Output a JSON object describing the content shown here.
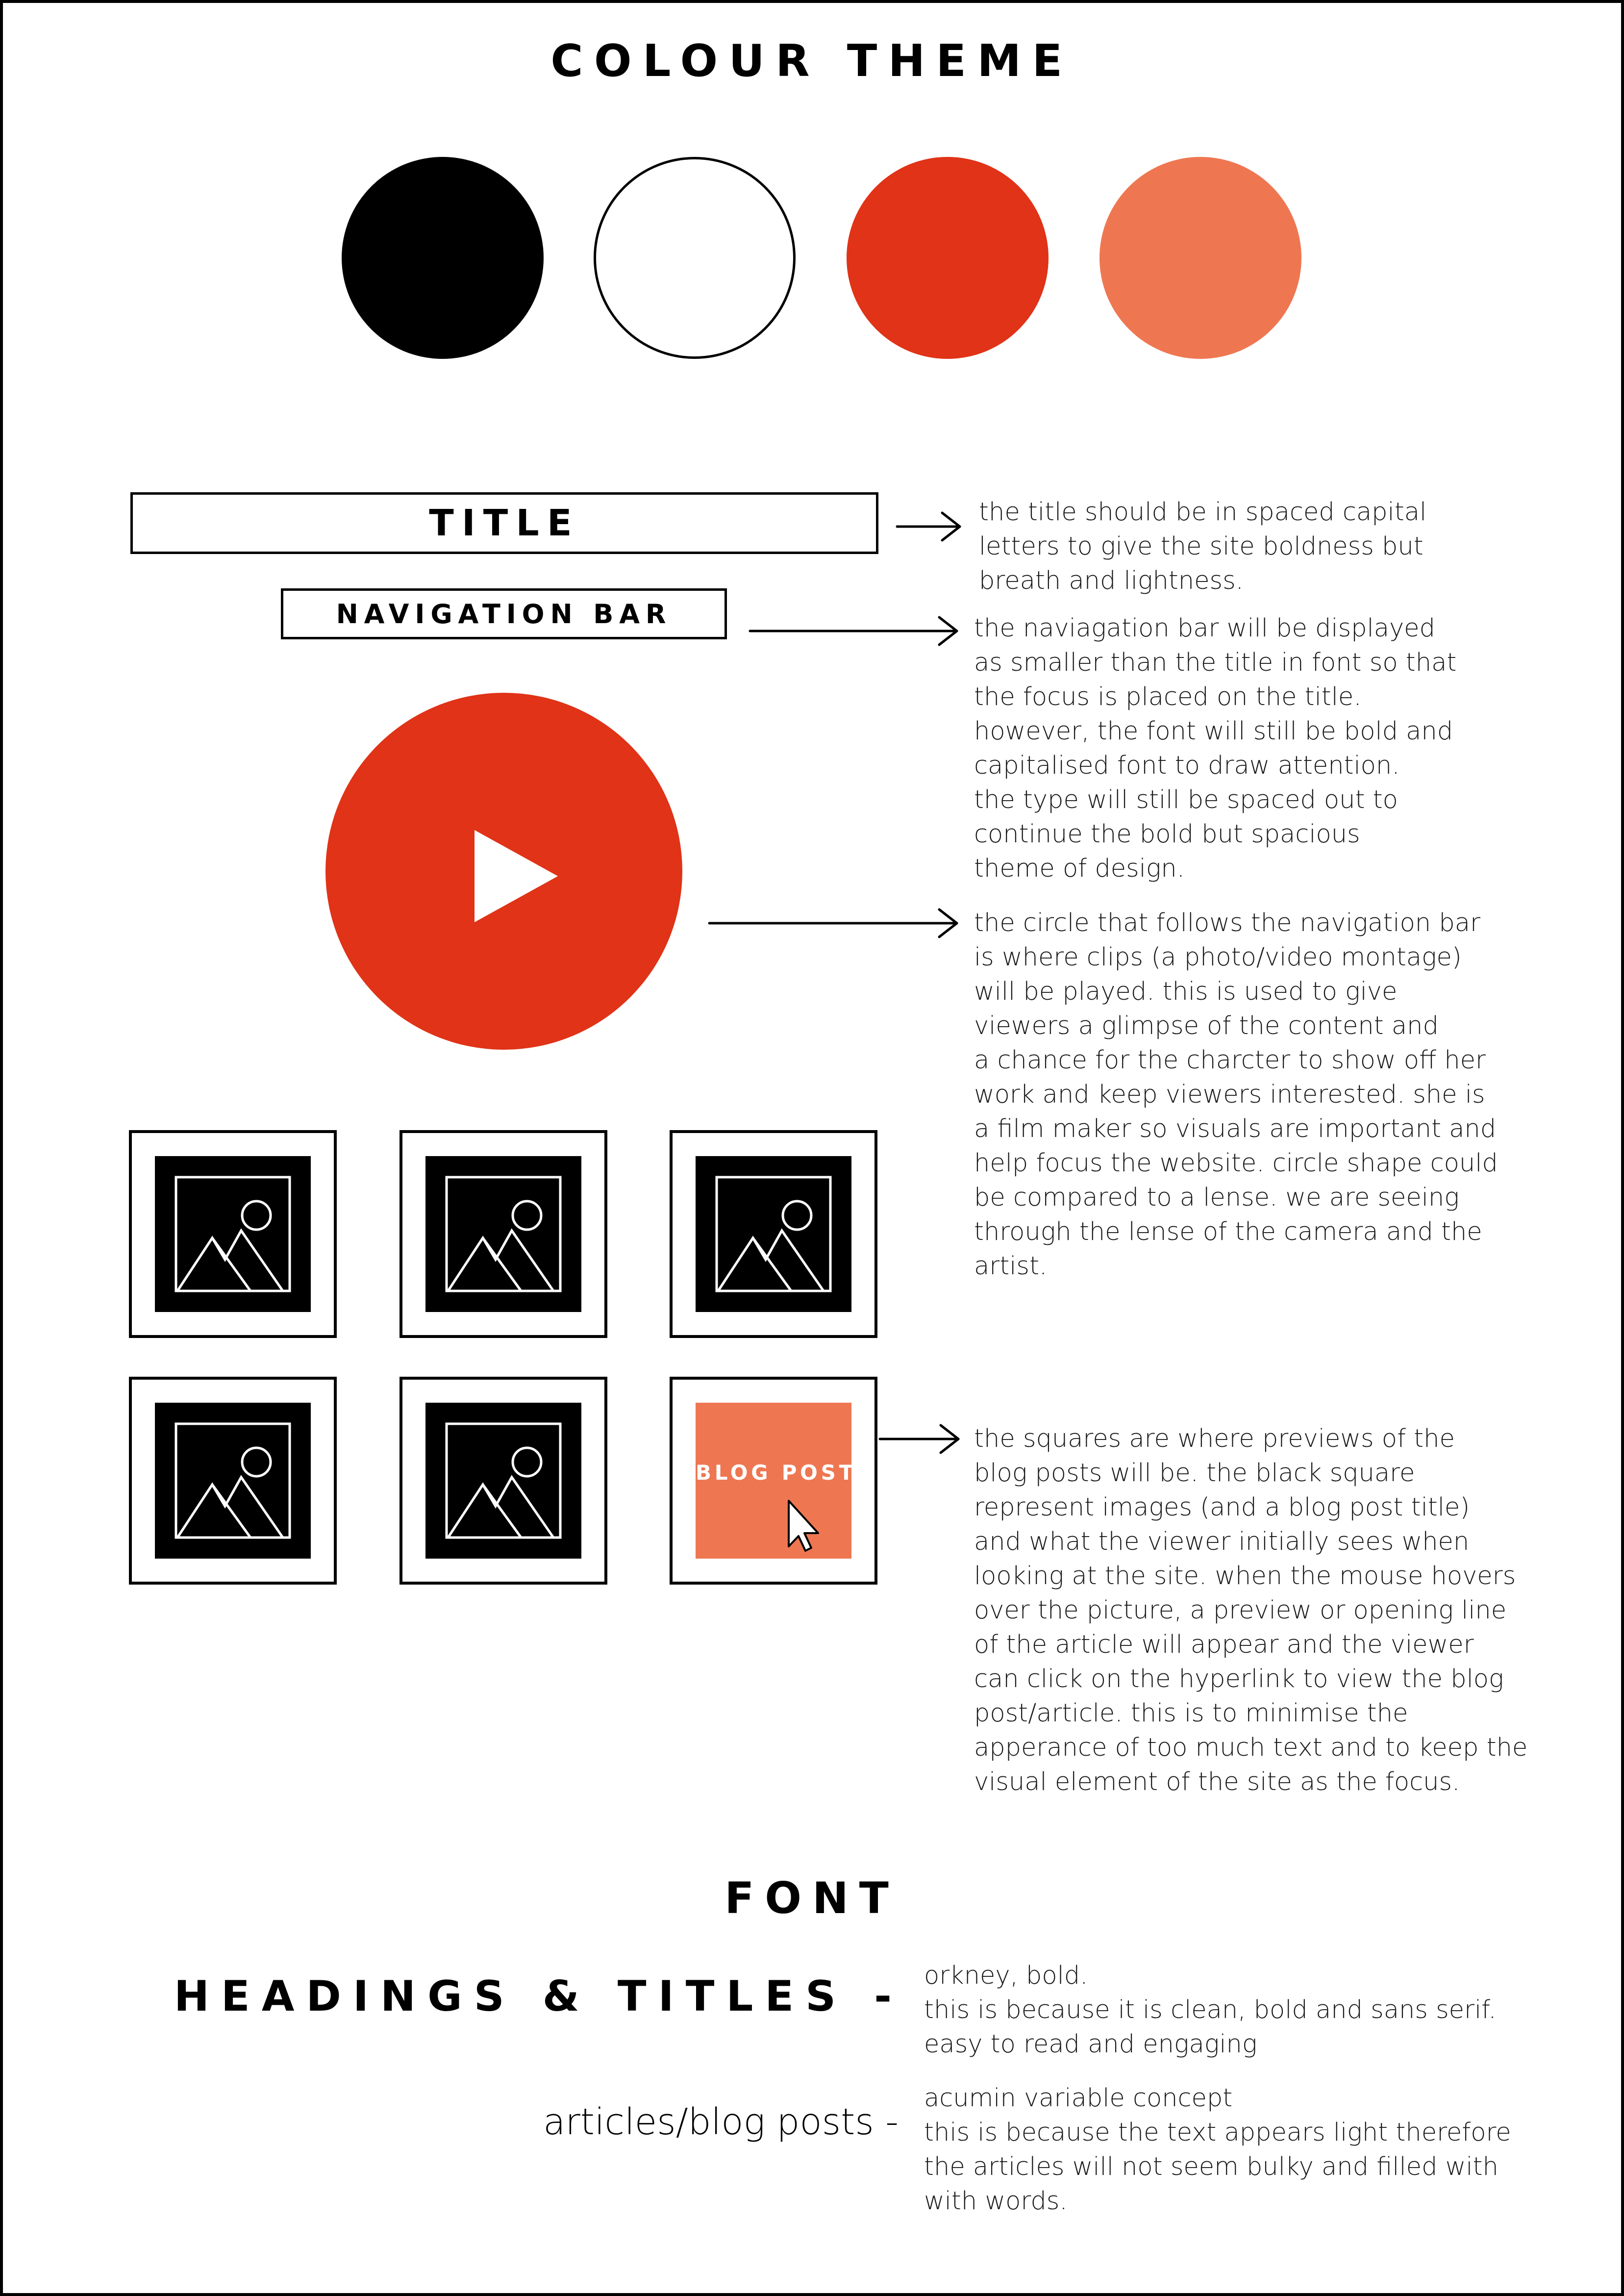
{
  "colour_theme": {
    "title": "COLOUR THEME",
    "swatches": [
      {
        "name": "black",
        "color": "#000000"
      },
      {
        "name": "white",
        "color": "#ffffff"
      },
      {
        "name": "red",
        "color": "#e03317"
      },
      {
        "name": "coral",
        "color": "#ee7752"
      }
    ]
  },
  "layout_mock": {
    "title_label": "TITLE",
    "nav_label": "NAVIGATION BAR",
    "title_note": "the title should be in spaced capital\nletters to give the site boldness but\nbreath and lightness.",
    "nav_note": "the naviagation bar will be displayed\nas smaller than the title in font so that\nthe focus is placed on the title.\nhowever, the font will still be bold and\ncapitalised font to draw attention.\nthe type will still be spaced out to\ncontinue the bold but spacious\ntheme of design.",
    "circle_note": "the circle that follows the navigation bar\nis where clips (a photo/video montage)\nwill be played. this is used to give\nviewers a glimpse of the content and\na chance for the charcter to show off her\nwork and keep viewers interested. she is\na film maker so visuals are important and\nhelp focus the website. circle shape could\nbe compared to a lense. we are seeing\nthrough the lense of the camera and the\nartist.",
    "blog_post_label": "BLOG POST",
    "squares_note": "the squares are where previews of the\nblog posts will be. the black square\nrepresent images (and a blog post title)\nand what the viewer initially sees when\nlooking at the site. when the mouse hovers\nover the picture, a preview or opening line\nof the article will appear and the viewer\ncan click on the hyperlink to view the blog\npost/article. this is to minimise the\napperance of too much text and to keep the\nvisual element of the site as the focus.",
    "play_circle_color": "#e03317",
    "blog_tile_color": "#ee7752"
  },
  "font": {
    "title": "FONT",
    "headings_label": "HEADINGS & TITLES -",
    "headings_note": "orkney, bold.\nthis is because it is clean, bold and sans serif.\neasy to read and engaging",
    "articles_label": "articles/blog posts  -",
    "articles_note": "acumin variable concept\nthis is because the text appears light therefore\nthe articles will not seem bulky and filled with\nwith words."
  }
}
